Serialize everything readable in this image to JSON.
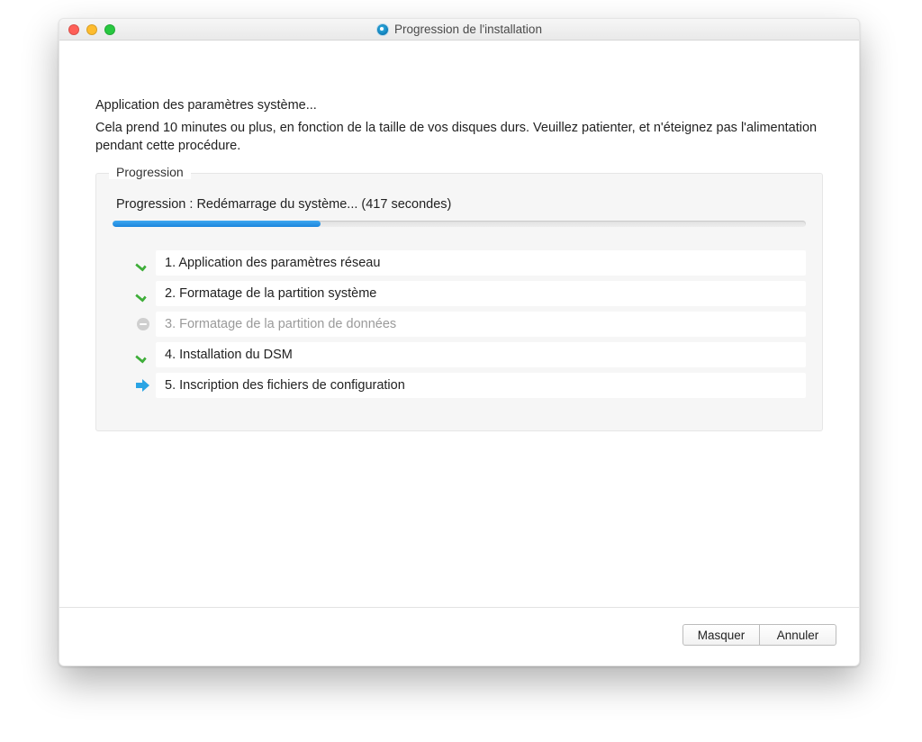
{
  "window": {
    "title": "Progression de l'installation"
  },
  "content": {
    "heading": "Application des paramètres système...",
    "subtext": "Cela prend 10 minutes ou plus, en fonction de la taille de vos disques durs. Veuillez patienter, et n'éteignez pas l'alimentation pendant cette procédure."
  },
  "panel": {
    "legend": "Progression",
    "progress_label": "Progression : Redémarrage du système... (417 secondes)",
    "progress_percent": 30,
    "steps": [
      {
        "label": "1. Application des paramètres réseau",
        "status": "done",
        "icon": "check-icon"
      },
      {
        "label": "2. Formatage de la partition système",
        "status": "done",
        "icon": "check-icon"
      },
      {
        "label": "3. Formatage de la partition de données",
        "status": "skipped",
        "icon": "skip-icon"
      },
      {
        "label": "4. Installation du DSM",
        "status": "done",
        "icon": "check-icon"
      },
      {
        "label": "5. Inscription des fichiers de configuration",
        "status": "current",
        "icon": "arrow-icon"
      }
    ]
  },
  "footer": {
    "hide_label": "Masquer",
    "cancel_label": "Annuler"
  }
}
